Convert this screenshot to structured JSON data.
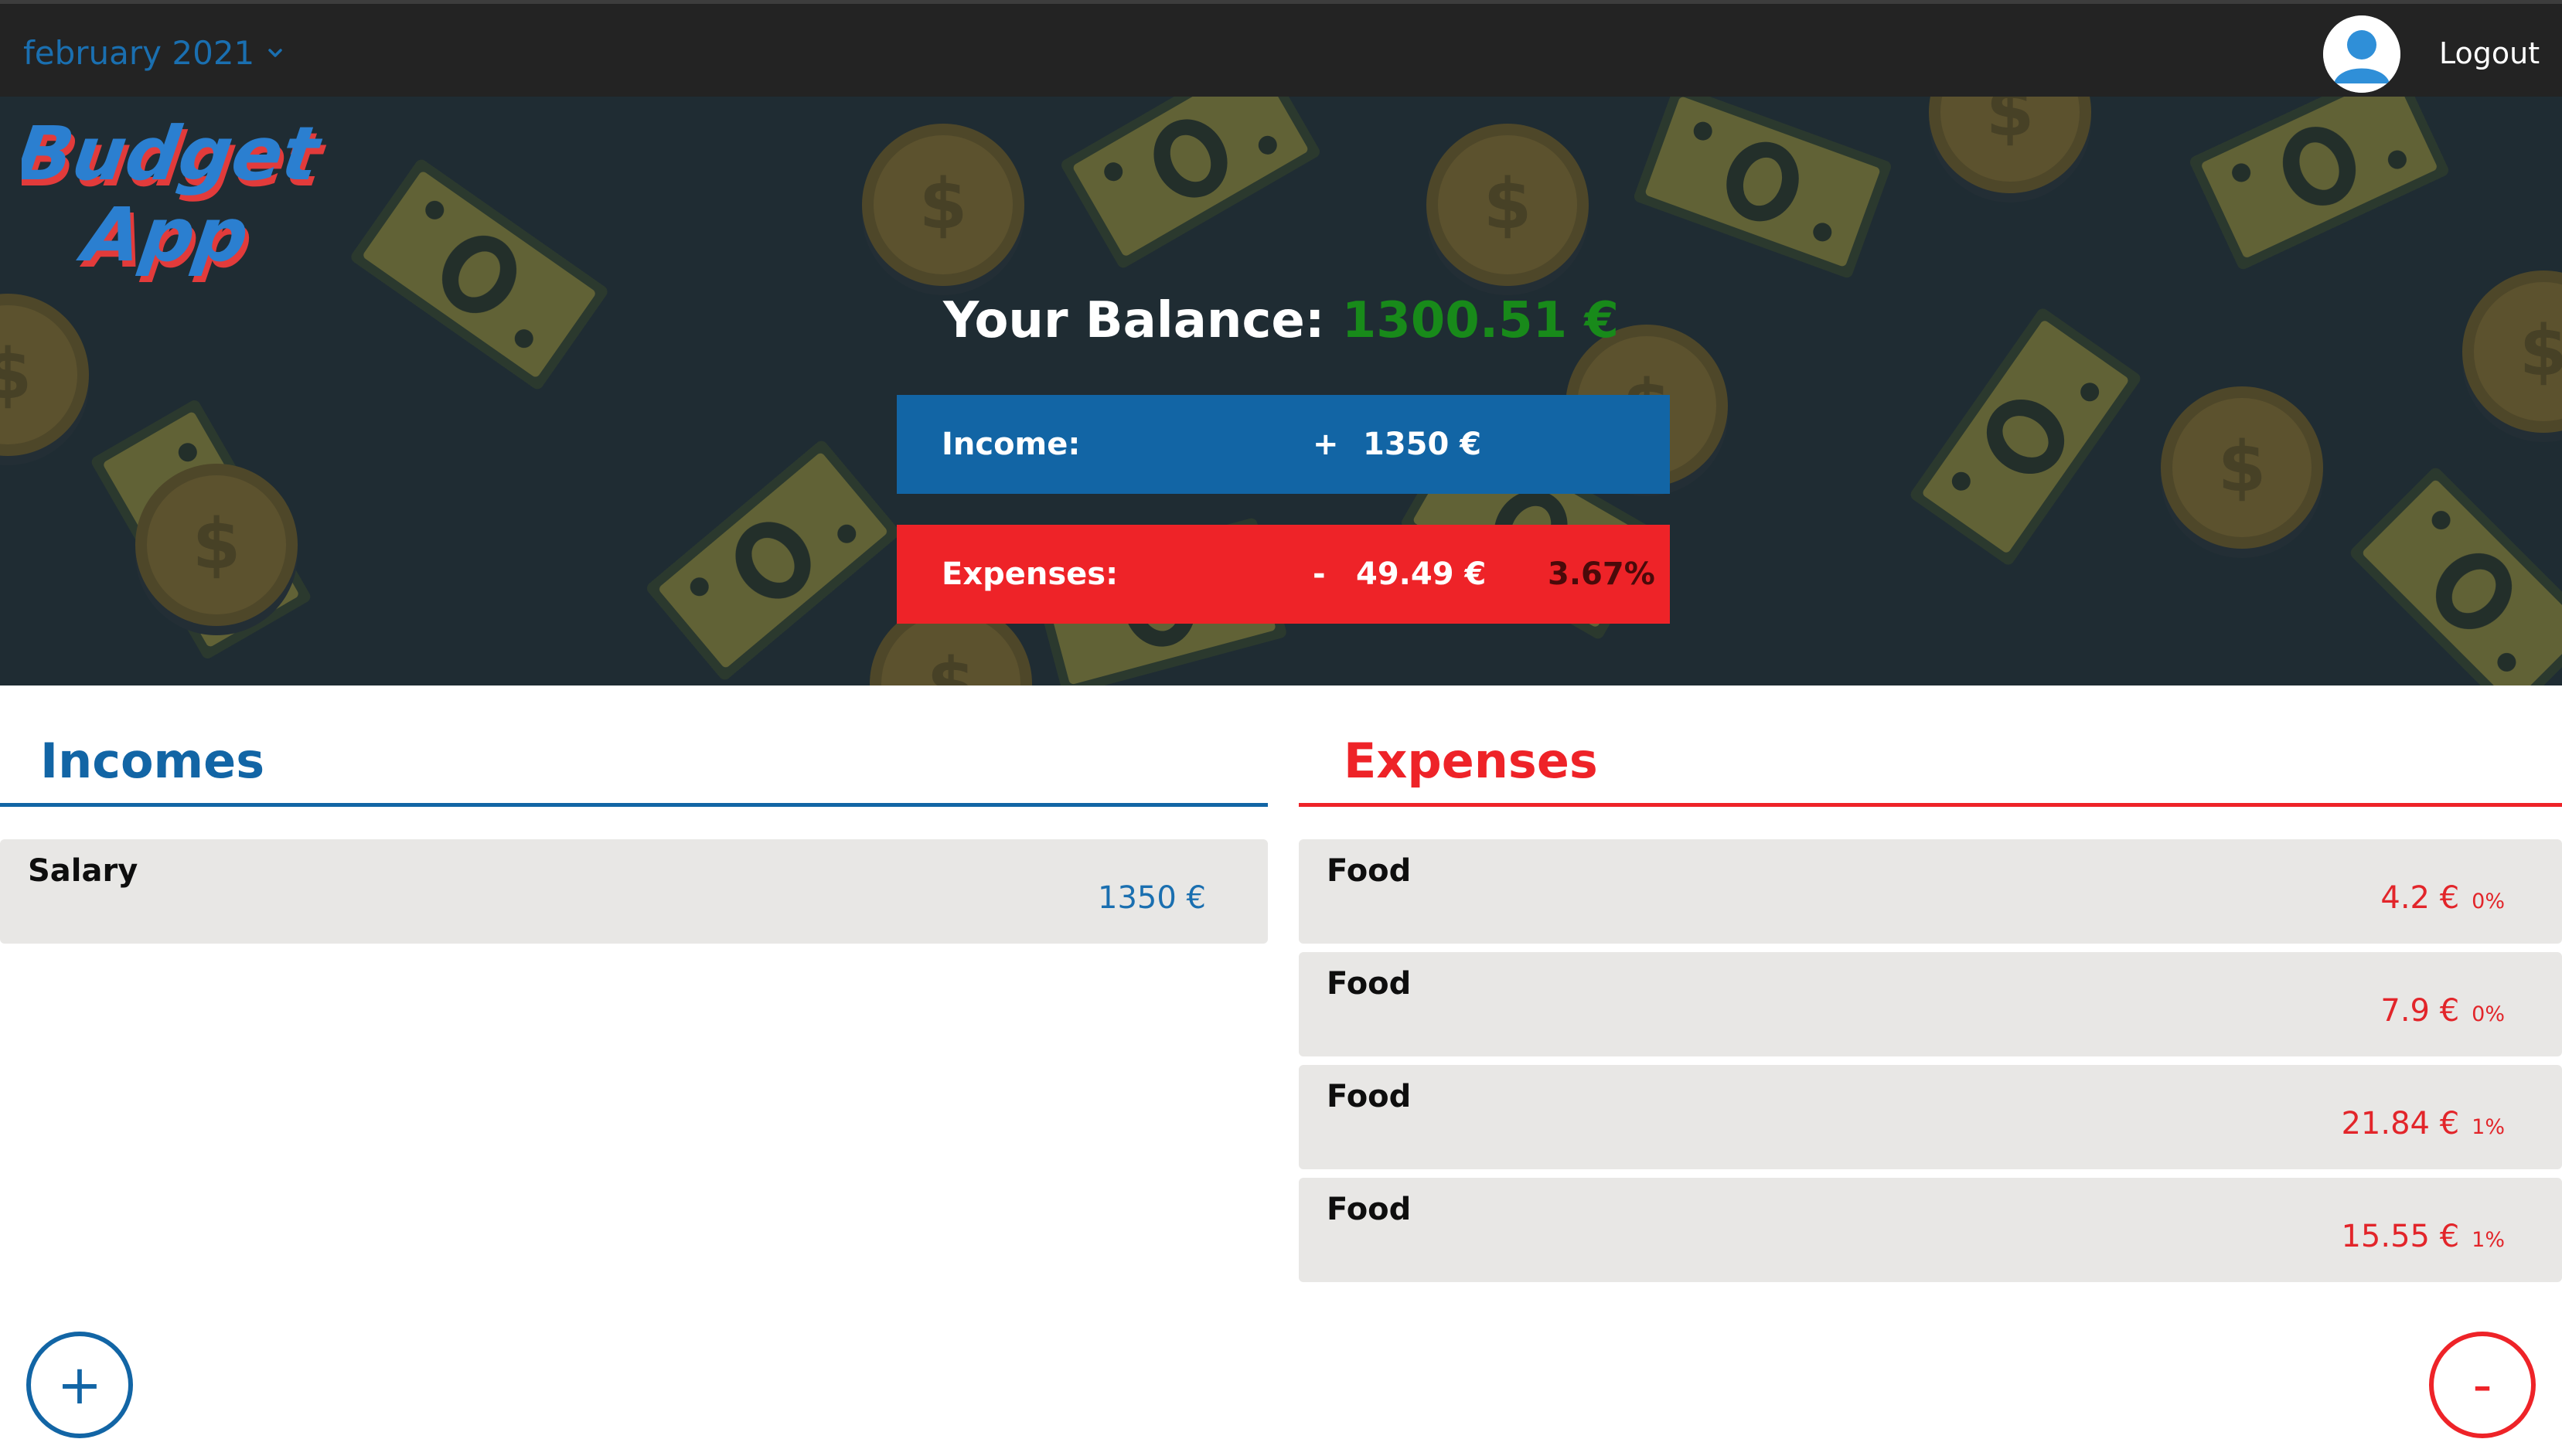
{
  "header": {
    "month": "february 2021",
    "logout_label": "Logout"
  },
  "brand": {
    "logo_text_line1": "Budget",
    "logo_text_line2": "App"
  },
  "balance": {
    "label": "Your Balance:",
    "amount": "1300.51 €"
  },
  "summary": {
    "income_label": "Income:",
    "income_sign": "+",
    "income_amount": "1350 €",
    "expenses_label": "Expenses:",
    "expenses_sign": "-",
    "expenses_amount": "49.49 €",
    "expenses_percent": "3.67%"
  },
  "incomes": {
    "title": "Incomes",
    "items": [
      {
        "name": "Salary",
        "value": "1350 €"
      }
    ],
    "add_label": "+"
  },
  "expenses": {
    "title": "Expenses",
    "items": [
      {
        "name": "Food",
        "value": "4.2 €",
        "percent": "0%"
      },
      {
        "name": "Food",
        "value": "7.9 €",
        "percent": "0%"
      },
      {
        "name": "Food",
        "value": "21.84 €",
        "percent": "1%"
      },
      {
        "name": "Food",
        "value": "15.55 €",
        "percent": "1%"
      }
    ],
    "add_label": "-"
  },
  "colors": {
    "income_blue": "#1265a5",
    "expense_red": "#ee2328",
    "balance_green": "#188a1a",
    "topbar": "#232323",
    "hero_bg": "#1f2c33"
  },
  "icons": {
    "month_dropdown": "chevron-down-icon",
    "avatar": "user-avatar-icon",
    "add_income": "plus-icon",
    "add_expense": "minus-icon"
  }
}
